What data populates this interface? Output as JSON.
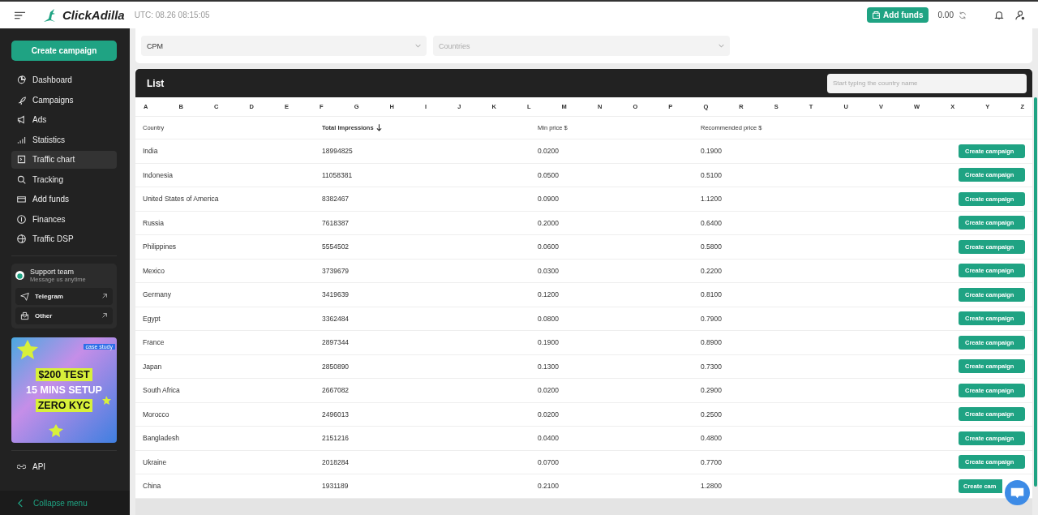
{
  "header": {
    "logo": "ClickAdilla",
    "clock": "UTC: 08.26 08:15:05",
    "add_funds": "Add funds",
    "balance": "0.00"
  },
  "sidebar": {
    "create_button": "Create campaign",
    "items": [
      {
        "label": "Dashboard",
        "selected": false
      },
      {
        "label": "Campaigns",
        "selected": false
      },
      {
        "label": "Ads",
        "selected": false
      },
      {
        "label": "Statistics",
        "selected": false
      },
      {
        "label": "Traffic chart",
        "selected": true
      },
      {
        "label": "Tracking",
        "selected": false
      },
      {
        "label": "Add funds",
        "selected": false
      },
      {
        "label": "Finances",
        "selected": false
      },
      {
        "label": "Traffic DSP",
        "selected": false
      }
    ],
    "support": {
      "title": "Support team",
      "subtitle": "Message us anytime",
      "links": [
        {
          "label": "Telegram"
        },
        {
          "label": "Other"
        }
      ]
    },
    "banner": {
      "tag": "case study",
      "lines": [
        {
          "text": "$200 TEST",
          "highlight": true
        },
        {
          "text": "15 MINS SETUP",
          "highlight": false
        },
        {
          "text": "ZERO KYC",
          "highlight": true
        }
      ]
    },
    "bottom_items": [
      {
        "label": "API"
      }
    ],
    "collapse": "Collapse menu"
  },
  "filters": [
    {
      "value": "CPM"
    },
    {
      "placeholder": "Countries"
    }
  ],
  "list": {
    "title": "List",
    "search_placeholder": "Start typing the country name",
    "letters": [
      "A",
      "B",
      "C",
      "D",
      "E",
      "F",
      "G",
      "H",
      "I",
      "J",
      "K",
      "L",
      "M",
      "N",
      "O",
      "P",
      "Q",
      "R",
      "S",
      "T",
      "U",
      "V",
      "W",
      "X",
      "Y",
      "Z"
    ],
    "columns": [
      {
        "label": "Country",
        "sorted": false
      },
      {
        "label": "Total Impressions",
        "sorted": true
      },
      {
        "label": "Min price $",
        "sorted": false
      },
      {
        "label": "Recommended price $",
        "sorted": false
      }
    ],
    "rows": [
      {
        "country": "India",
        "impressions": "18994825",
        "min": "0.0200",
        "rec": "0.1900",
        "action": "Create campaign"
      },
      {
        "country": "Indonesia",
        "impressions": "11058381",
        "min": "0.0500",
        "rec": "0.5100",
        "action": "Create campaign"
      },
      {
        "country": "United States of America",
        "impressions": "8382467",
        "min": "0.0900",
        "rec": "1.1200",
        "action": "Create campaign"
      },
      {
        "country": "Russia",
        "impressions": "7618387",
        "min": "0.2000",
        "rec": "0.6400",
        "action": "Create campaign"
      },
      {
        "country": "Philippines",
        "impressions": "5554502",
        "min": "0.0600",
        "rec": "0.5800",
        "action": "Create campaign"
      },
      {
        "country": "Mexico",
        "impressions": "3739679",
        "min": "0.0300",
        "rec": "0.2200",
        "action": "Create campaign"
      },
      {
        "country": "Germany",
        "impressions": "3419639",
        "min": "0.1200",
        "rec": "0.8100",
        "action": "Create campaign"
      },
      {
        "country": "Egypt",
        "impressions": "3362484",
        "min": "0.0800",
        "rec": "0.7900",
        "action": "Create campaign"
      },
      {
        "country": "France",
        "impressions": "2897344",
        "min": "0.1900",
        "rec": "0.8900",
        "action": "Create campaign"
      },
      {
        "country": "Japan",
        "impressions": "2850890",
        "min": "0.1300",
        "rec": "0.7300",
        "action": "Create campaign"
      },
      {
        "country": "South Africa",
        "impressions": "2667082",
        "min": "0.0200",
        "rec": "0.2900",
        "action": "Create campaign"
      },
      {
        "country": "Morocco",
        "impressions": "2496013",
        "min": "0.0200",
        "rec": "0.2500",
        "action": "Create campaign"
      },
      {
        "country": "Bangladesh",
        "impressions": "2151216",
        "min": "0.0400",
        "rec": "0.4800",
        "action": "Create campaign"
      },
      {
        "country": "Ukraine",
        "impressions": "2018284",
        "min": "0.0700",
        "rec": "0.7700",
        "action": "Create campaign"
      },
      {
        "country": "China",
        "impressions": "1931189",
        "min": "0.2100",
        "rec": "1.2800",
        "action": "Create cam"
      }
    ]
  }
}
